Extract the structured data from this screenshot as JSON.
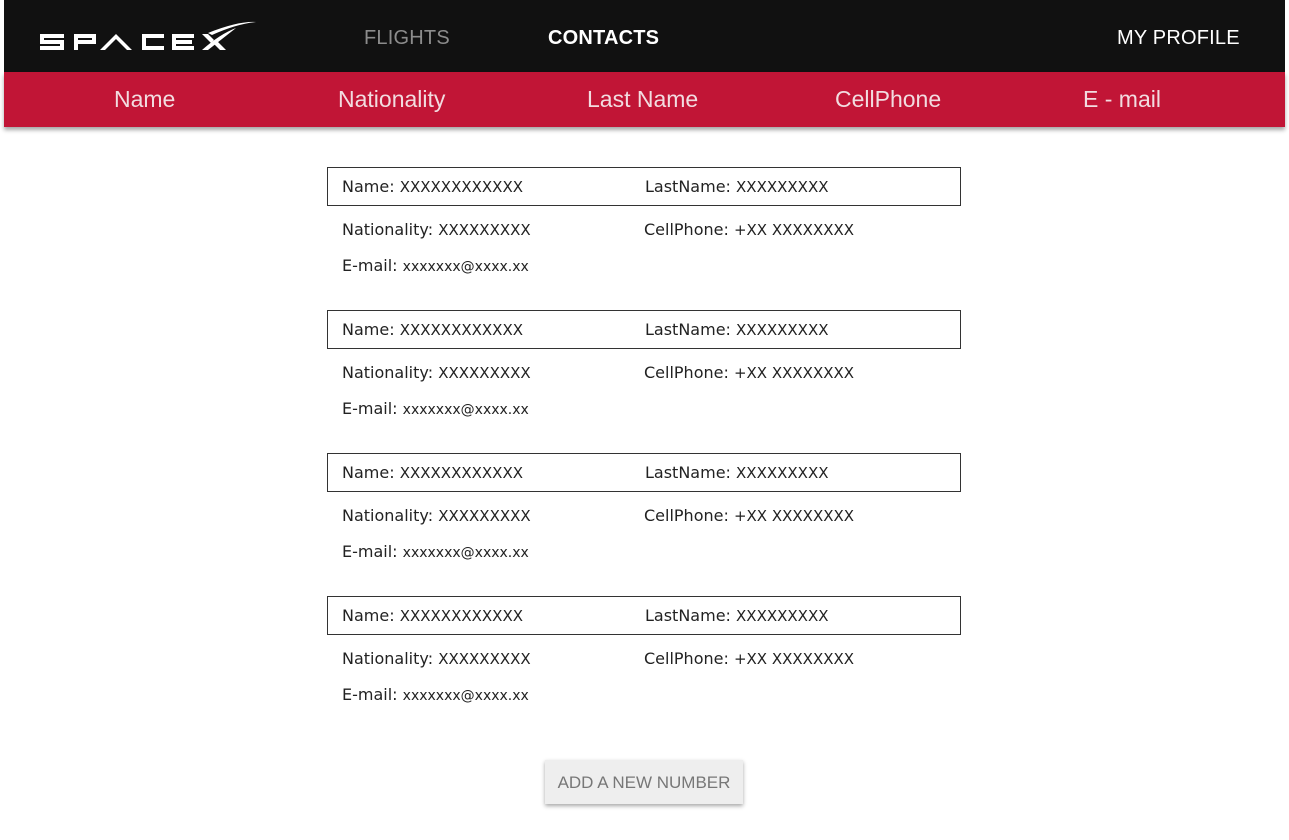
{
  "header": {
    "logo_text": "SPACEX",
    "nav": {
      "flights": "FLIGHTS",
      "contacts": "CONTACTS",
      "profile": "MY PROFILE"
    }
  },
  "columns": [
    "Name",
    "Nationality",
    "Last Name",
    "CellPhone",
    "E - mail"
  ],
  "contacts": [
    {
      "name_label": "Name:",
      "name": "XXXXXXXXXXXX",
      "lastname_label": "LastName:",
      "lastname": "XXXXXXXXX",
      "nationality_label": "Nationality:",
      "nationality": "XXXXXXXXX",
      "cellphone_label": "CellPhone:",
      "cellphone": "+XX XXXXXXXX",
      "email_label": "E-mail:",
      "email": "xxxxxxx@xxxx.xx"
    },
    {
      "name_label": "Name:",
      "name": "XXXXXXXXXXXX",
      "lastname_label": "LastName:",
      "lastname": "XXXXXXXXX",
      "nationality_label": "Nationality:",
      "nationality": "XXXXXXXXX",
      "cellphone_label": "CellPhone:",
      "cellphone": "+XX XXXXXXXX",
      "email_label": "E-mail:",
      "email": "xxxxxxx@xxxx.xx"
    },
    {
      "name_label": "Name:",
      "name": "XXXXXXXXXXXX",
      "lastname_label": "LastName:",
      "lastname": "XXXXXXXXX",
      "nationality_label": "Nationality:",
      "nationality": "XXXXXXXXX",
      "cellphone_label": "CellPhone:",
      "cellphone": "+XX XXXXXXXX",
      "email_label": "E-mail:",
      "email": "xxxxxxx@xxxx.xx"
    },
    {
      "name_label": "Name:",
      "name": "XXXXXXXXXXXX",
      "lastname_label": "LastName:",
      "lastname": "XXXXXXXXX",
      "nationality_label": "Nationality:",
      "nationality": "XXXXXXXXX",
      "cellphone_label": "CellPhone:",
      "cellphone": "+XX XXXXXXXX",
      "email_label": "E-mail:",
      "email": "xxxxxxx@xxxx.xx"
    }
  ],
  "add_button_label": "ADD A NEW NUMBER",
  "colors": {
    "topbar": "#111111",
    "accent": "#c11536",
    "nav_inactive": "#8c8c8c",
    "nav_active": "#ffffff"
  }
}
